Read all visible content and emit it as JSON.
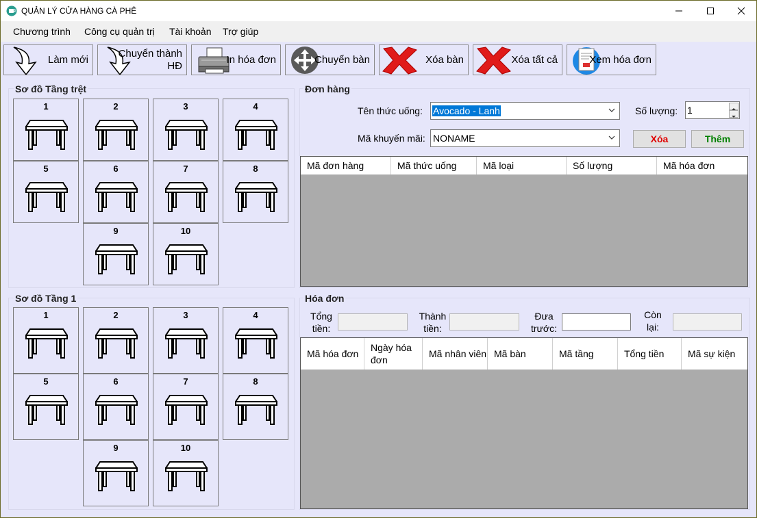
{
  "window": {
    "title": "QUẢN LÝ CỬA HÀNG CÀ PHÊ",
    "controls": [
      "minimize",
      "maximize",
      "close"
    ]
  },
  "menu": [
    "Chương trình",
    "Công cụ quản trị",
    "Tài khoản",
    "Trợ giúp"
  ],
  "toolbar": [
    {
      "label": "Làm mới",
      "icon": "arrow-down-icon"
    },
    {
      "label": "Chuyển thành HĐ",
      "icon": "arrow-down-icon"
    },
    {
      "label": "In hóa đơn",
      "icon": "printer-icon"
    },
    {
      "label": "Chuyển bàn",
      "icon": "move-icon"
    },
    {
      "label": "Xóa bàn",
      "icon": "red-x-icon"
    },
    {
      "label": "Xóa tất cả",
      "icon": "red-x-icon"
    },
    {
      "label": "Xem hóa đơn",
      "icon": "receipt-icon"
    }
  ],
  "floor_ground": {
    "title": "Sơ đồ Tầng trệt",
    "tables": [
      "1",
      "2",
      "3",
      "4",
      "5",
      "6",
      "7",
      "8",
      "9",
      "10"
    ]
  },
  "floor_one": {
    "title": "Sơ đồ Tầng 1",
    "tables": [
      "1",
      "2",
      "3",
      "4",
      "5",
      "6",
      "7",
      "8",
      "9",
      "10"
    ]
  },
  "order": {
    "title": "Đơn hàng",
    "drink_label": "Tên thức uống:",
    "drink_value": "Avocado - Lanh",
    "qty_label": "Số lượng:",
    "qty_value": "1",
    "promo_label": "Mã khuyến mãi:",
    "promo_value": "NONAME",
    "delete_label": "Xóa",
    "add_label": "Thêm",
    "columns": [
      "Mã đơn hàng",
      "Mã thức uống",
      "Mã loại",
      "Số lượng",
      "Mã hóa đơn"
    ]
  },
  "invoice": {
    "title": "Hóa đơn",
    "total_label": "Tổng tiền:",
    "amount_label": "Thành tiền:",
    "paid_label": "Đưa trước:",
    "remaining_label": "Còn lại:",
    "columns": [
      "Mã hóa đơn",
      "Ngày hóa đơn",
      "Mã nhân viên",
      "Mã bàn",
      "Mã tầng",
      "Tổng tiền",
      "Mã sự kiện"
    ]
  },
  "colors": {
    "background": "#e6e6fa",
    "grid_empty": "#ababab",
    "delete_text": "#e00000",
    "add_text": "#008000",
    "selection": "#0078d7"
  }
}
